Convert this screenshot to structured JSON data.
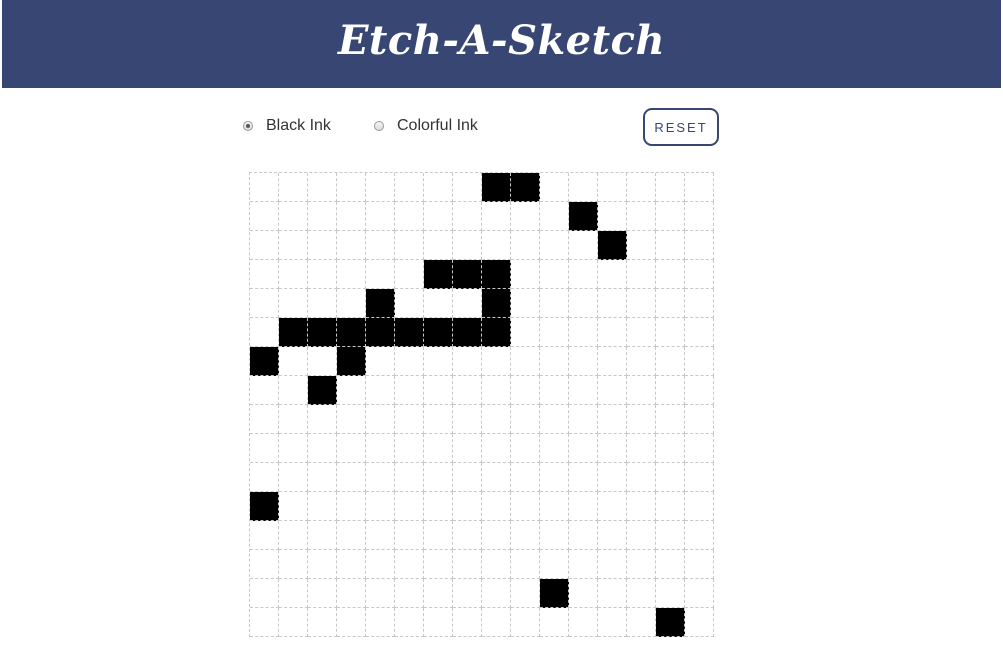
{
  "header": {
    "title": "Etch-A-Sketch",
    "background_color": "#374672"
  },
  "controls": {
    "ink_options": [
      {
        "label": "Black Ink",
        "selected": true
      },
      {
        "label": "Colorful Ink",
        "selected": false
      }
    ],
    "reset_label": "RESET"
  },
  "grid": {
    "rows": 16,
    "columns": 16,
    "ink_color": "#000000",
    "filled_cells": [
      [
        0,
        8
      ],
      [
        0,
        9
      ],
      [
        1,
        11
      ],
      [
        2,
        12
      ],
      [
        3,
        6
      ],
      [
        3,
        7
      ],
      [
        3,
        8
      ],
      [
        4,
        4
      ],
      [
        4,
        8
      ],
      [
        5,
        1
      ],
      [
        5,
        2
      ],
      [
        5,
        3
      ],
      [
        5,
        4
      ],
      [
        5,
        5
      ],
      [
        5,
        6
      ],
      [
        5,
        7
      ],
      [
        5,
        8
      ],
      [
        6,
        0
      ],
      [
        6,
        3
      ],
      [
        7,
        2
      ],
      [
        11,
        0
      ],
      [
        14,
        10
      ],
      [
        15,
        14
      ]
    ]
  }
}
